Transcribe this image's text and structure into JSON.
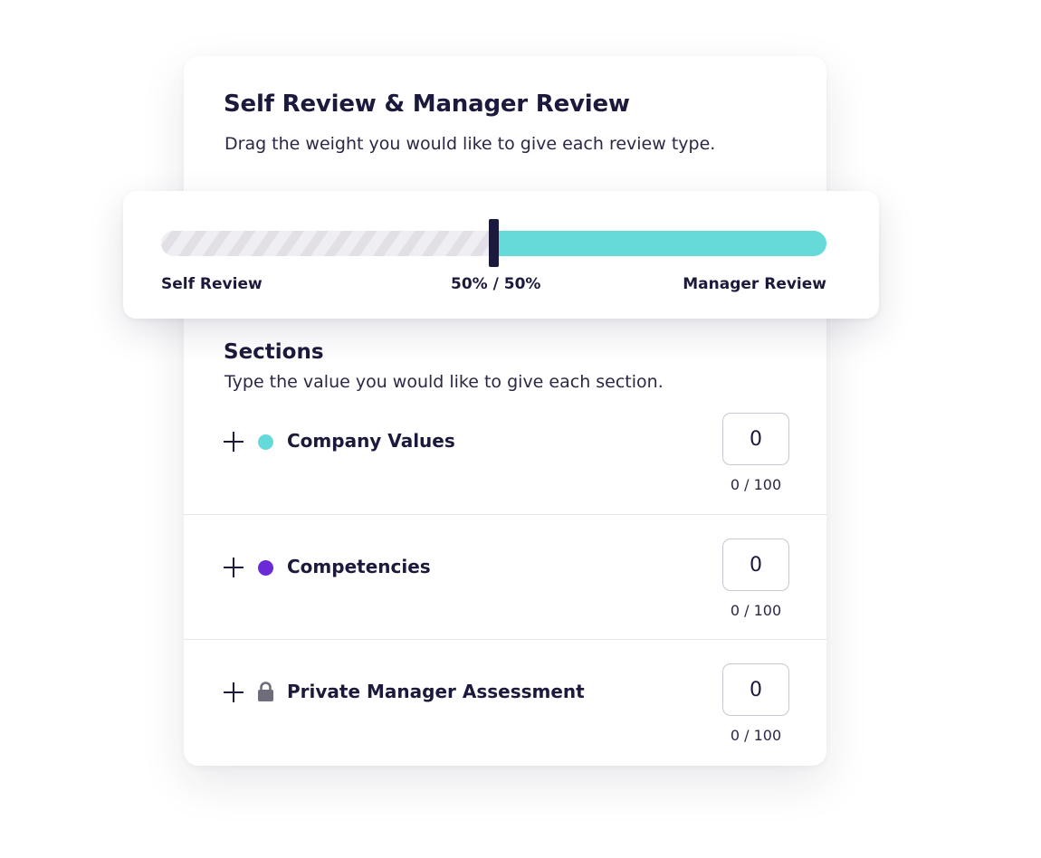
{
  "card": {
    "title": "Self Review & Manager Review",
    "subtitle": "Drag the weight you would like to give each review type."
  },
  "slider": {
    "left_label": "Self Review",
    "center_label": "50% / 50%",
    "right_label": "Manager Review",
    "self_weight_fraction": 0.5,
    "manager_color": "#66d9d9",
    "handle_color": "#1c1a3c"
  },
  "sections": {
    "title": "Sections",
    "subtitle": "Type the value you would like to give each section.",
    "items": [
      {
        "label": "Company Values",
        "icon": "dot-icon",
        "color": "#66d9d9",
        "value": "0",
        "hint": "0 / 100"
      },
      {
        "label": "Competencies",
        "icon": "dot-icon",
        "color": "#6a2ad8",
        "value": "0",
        "hint": "0 / 100"
      },
      {
        "label": "Private Manager Assessment",
        "icon": "lock-icon",
        "color": "#6f6d7c",
        "value": "0",
        "hint": "0 / 100"
      }
    ]
  }
}
